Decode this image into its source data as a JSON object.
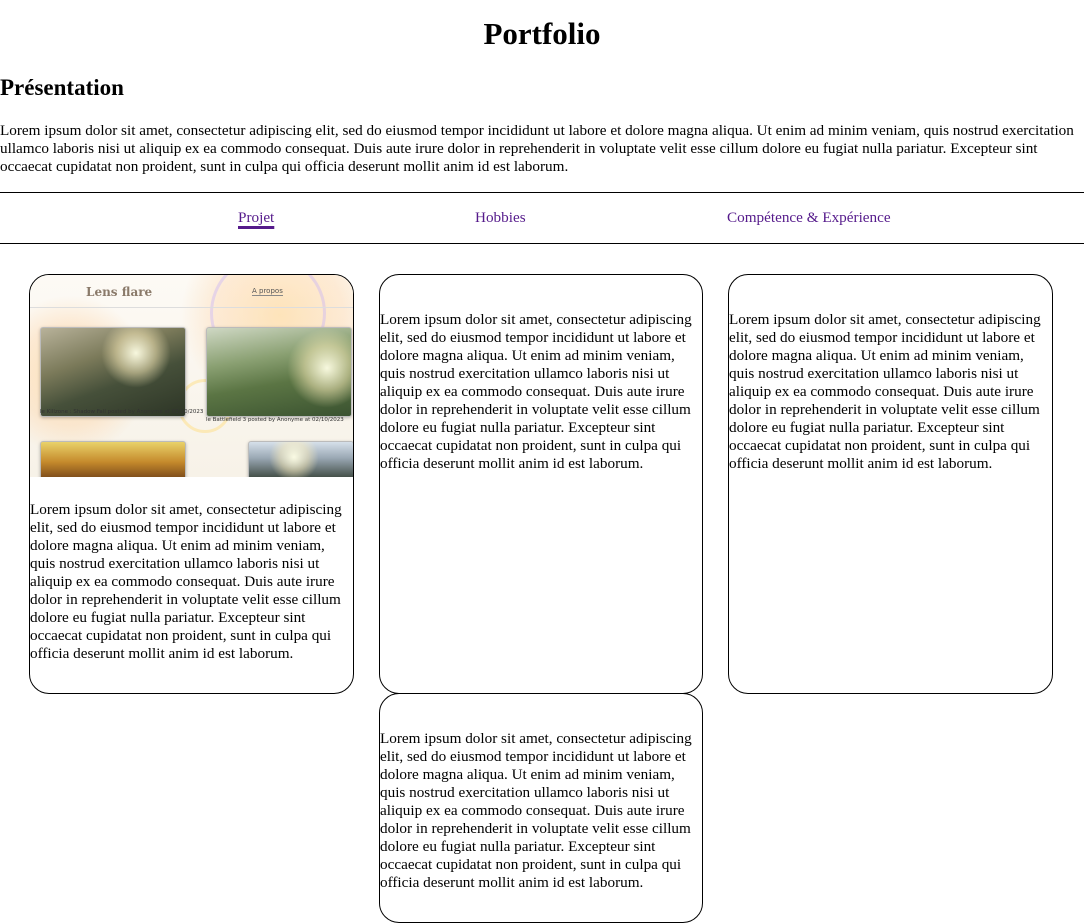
{
  "page": {
    "title": "Portfolio",
    "section_title": "Présentation",
    "intro": "Lorem ipsum dolor sit amet, consectetur adipiscing elit, sed do eiusmod tempor incididunt ut labore et dolore magna aliqua. Ut enim ad minim veniam, quis nostrud exercitation ullamco laboris nisi ut aliquip ex ea commodo consequat. Duis aute irure dolor in reprehenderit in voluptate velit esse cillum dolore eu fugiat nulla pariatur. Excepteur sint occaecat cupidatat non proident, sunt in culpa qui officia deserunt mollit anim id est laborum."
  },
  "nav": {
    "items": [
      {
        "label": "Projet",
        "active": true
      },
      {
        "label": "Hobbies",
        "active": false
      },
      {
        "label": "Compétence & Expérience",
        "active": false
      }
    ],
    "link_color": "#551a8b"
  },
  "cards": [
    {
      "text": "Lorem ipsum dolor sit amet, consectetur adipiscing elit, sed do eiusmod tempor incididunt ut labore et dolore magna aliqua. Ut enim ad minim veniam, quis nostrud exercitation ullamco laboris nisi ut aliquip ex ea commodo consequat. Duis aute irure dolor in reprehenderit in voluptate velit esse cillum dolore eu fugiat nulla pariatur. Excepteur sint occaecat cupidatat non proident, sunt in culpa qui officia deserunt mollit anim id est laborum."
    },
    {
      "text": "Lorem ipsum dolor sit amet, consectetur adipiscing elit, sed do eiusmod tempor incididunt ut labore et dolore magna aliqua. Ut enim ad minim veniam, quis nostrud exercitation ullamco laboris nisi ut aliquip ex ea commodo consequat. Duis aute irure dolor in reprehenderit in voluptate velit esse cillum dolore eu fugiat nulla pariatur. Excepteur sint occaecat cupidatat non proident, sunt in culpa qui officia deserunt mollit anim id est laborum."
    },
    {
      "text": "Lorem ipsum dolor sit amet, consectetur adipiscing elit, sed do eiusmod tempor incididunt ut labore et dolore magna aliqua. Ut enim ad minim veniam, quis nostrud exercitation ullamco laboris nisi ut aliquip ex ea commodo consequat. Duis aute irure dolor in reprehenderit in voluptate velit esse cillum dolore eu fugiat nulla pariatur. Excepteur sint occaecat cupidatat non proident, sunt in culpa qui officia deserunt mollit anim id est laborum."
    },
    {
      "text": "Lorem ipsum dolor sit amet, consectetur adipiscing elit, sed do eiusmod tempor incididunt ut labore et dolore magna aliqua. Ut enim ad minim veniam, quis nostrud exercitation ullamco laboris nisi ut aliquip ex ea commodo consequat. Duis aute irure dolor in reprehenderit in voluptate velit esse cillum dolore eu fugiat nulla pariatur. Excepteur sint occaecat cupidatat non proident, sunt in culpa qui officia deserunt mollit anim id est laborum."
    }
  ],
  "project_thumbnail": {
    "site_title": "Lens flare",
    "site_nav": "A propos",
    "caption_left": "le Killzone : Shadow Fall posted by Anonyme at 02/10/2023",
    "caption_right": "le Battlefield 3 posted by Anonyme at 02/10/2023"
  }
}
